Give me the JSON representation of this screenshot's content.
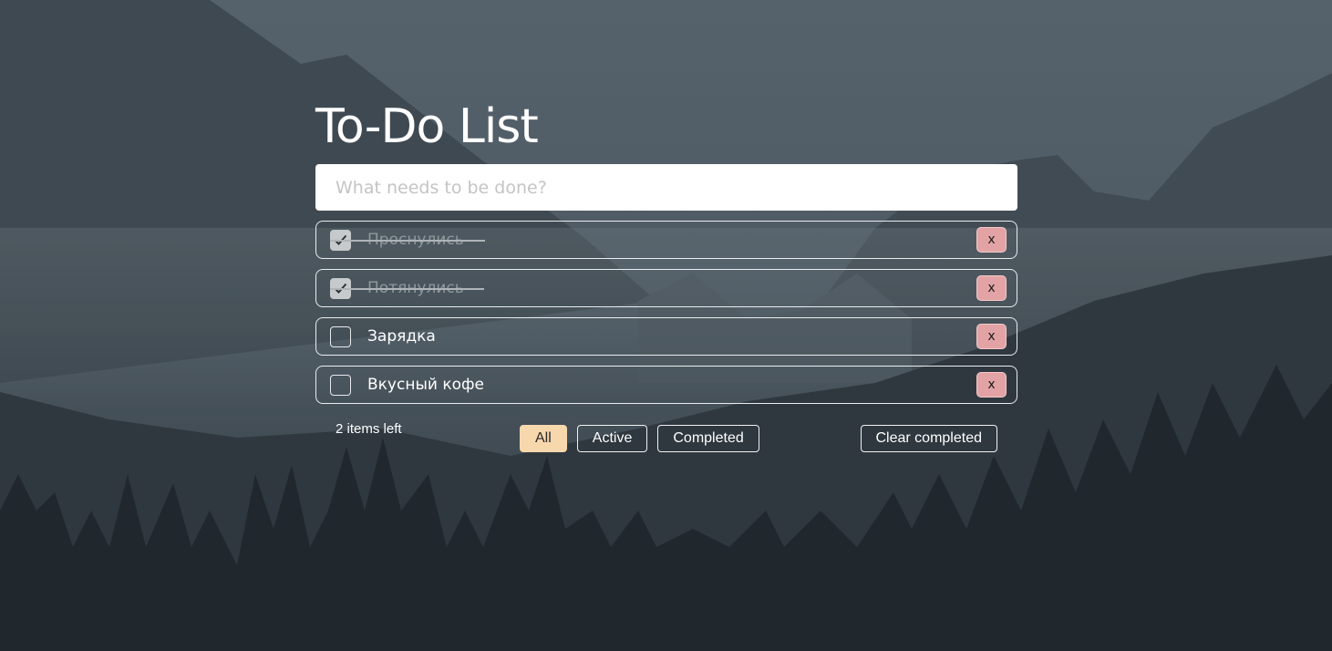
{
  "app": {
    "title": "To-Do List"
  },
  "new_todo": {
    "placeholder": "What needs to be done?",
    "value": ""
  },
  "todos": [
    {
      "text": "Проснулись",
      "completed": true
    },
    {
      "text": "Потянулись",
      "completed": true
    },
    {
      "text": "Зарядка",
      "completed": false
    },
    {
      "text": "Вкусный кофе",
      "completed": false
    }
  ],
  "delete_label": "x",
  "footer": {
    "items_left": "2 items left",
    "filters": [
      {
        "label": "All",
        "selected": true
      },
      {
        "label": "Active",
        "selected": false
      },
      {
        "label": "Completed",
        "selected": false
      }
    ],
    "clear_completed": "Clear completed"
  },
  "colors": {
    "selected_filter": "#f7d7ac",
    "delete_button": "#e3a3a4",
    "checked_box": "#c6cacd"
  },
  "icons": {
    "checkmark": "check-icon",
    "background": "mountain-forest-background"
  }
}
